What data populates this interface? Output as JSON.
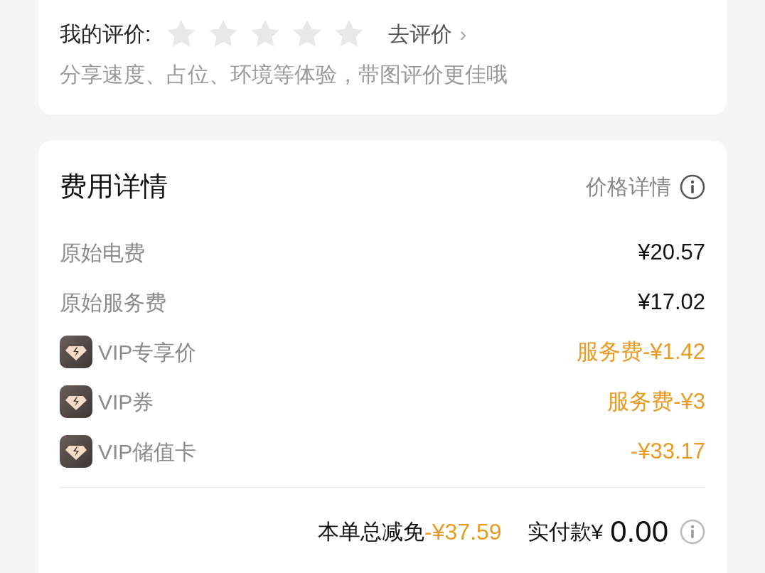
{
  "review": {
    "label": "我的评价:",
    "stars": 0,
    "link": "去评价",
    "chevron": "›",
    "hint": "分享速度、占位、环境等体验，带图评价更佳哦"
  },
  "fees": {
    "title": "费用详情",
    "detail_link": "价格详情",
    "items": [
      {
        "kind": "plain",
        "label": "原始电费",
        "amount": "¥20.57"
      },
      {
        "kind": "plain",
        "label": "原始服务费",
        "amount": "¥17.02"
      },
      {
        "kind": "vip",
        "label": "VIP专享价",
        "amount": "服务费-¥1.42"
      },
      {
        "kind": "vip",
        "label": "VIP券",
        "amount": "服务费-¥3"
      },
      {
        "kind": "vip",
        "label": "VIP储值卡",
        "amount": "-¥33.17"
      }
    ],
    "summary": {
      "discount_label": "本单总减免",
      "discount": "-¥37.59",
      "paid_label": "实付款¥",
      "paid": "0.00"
    }
  }
}
